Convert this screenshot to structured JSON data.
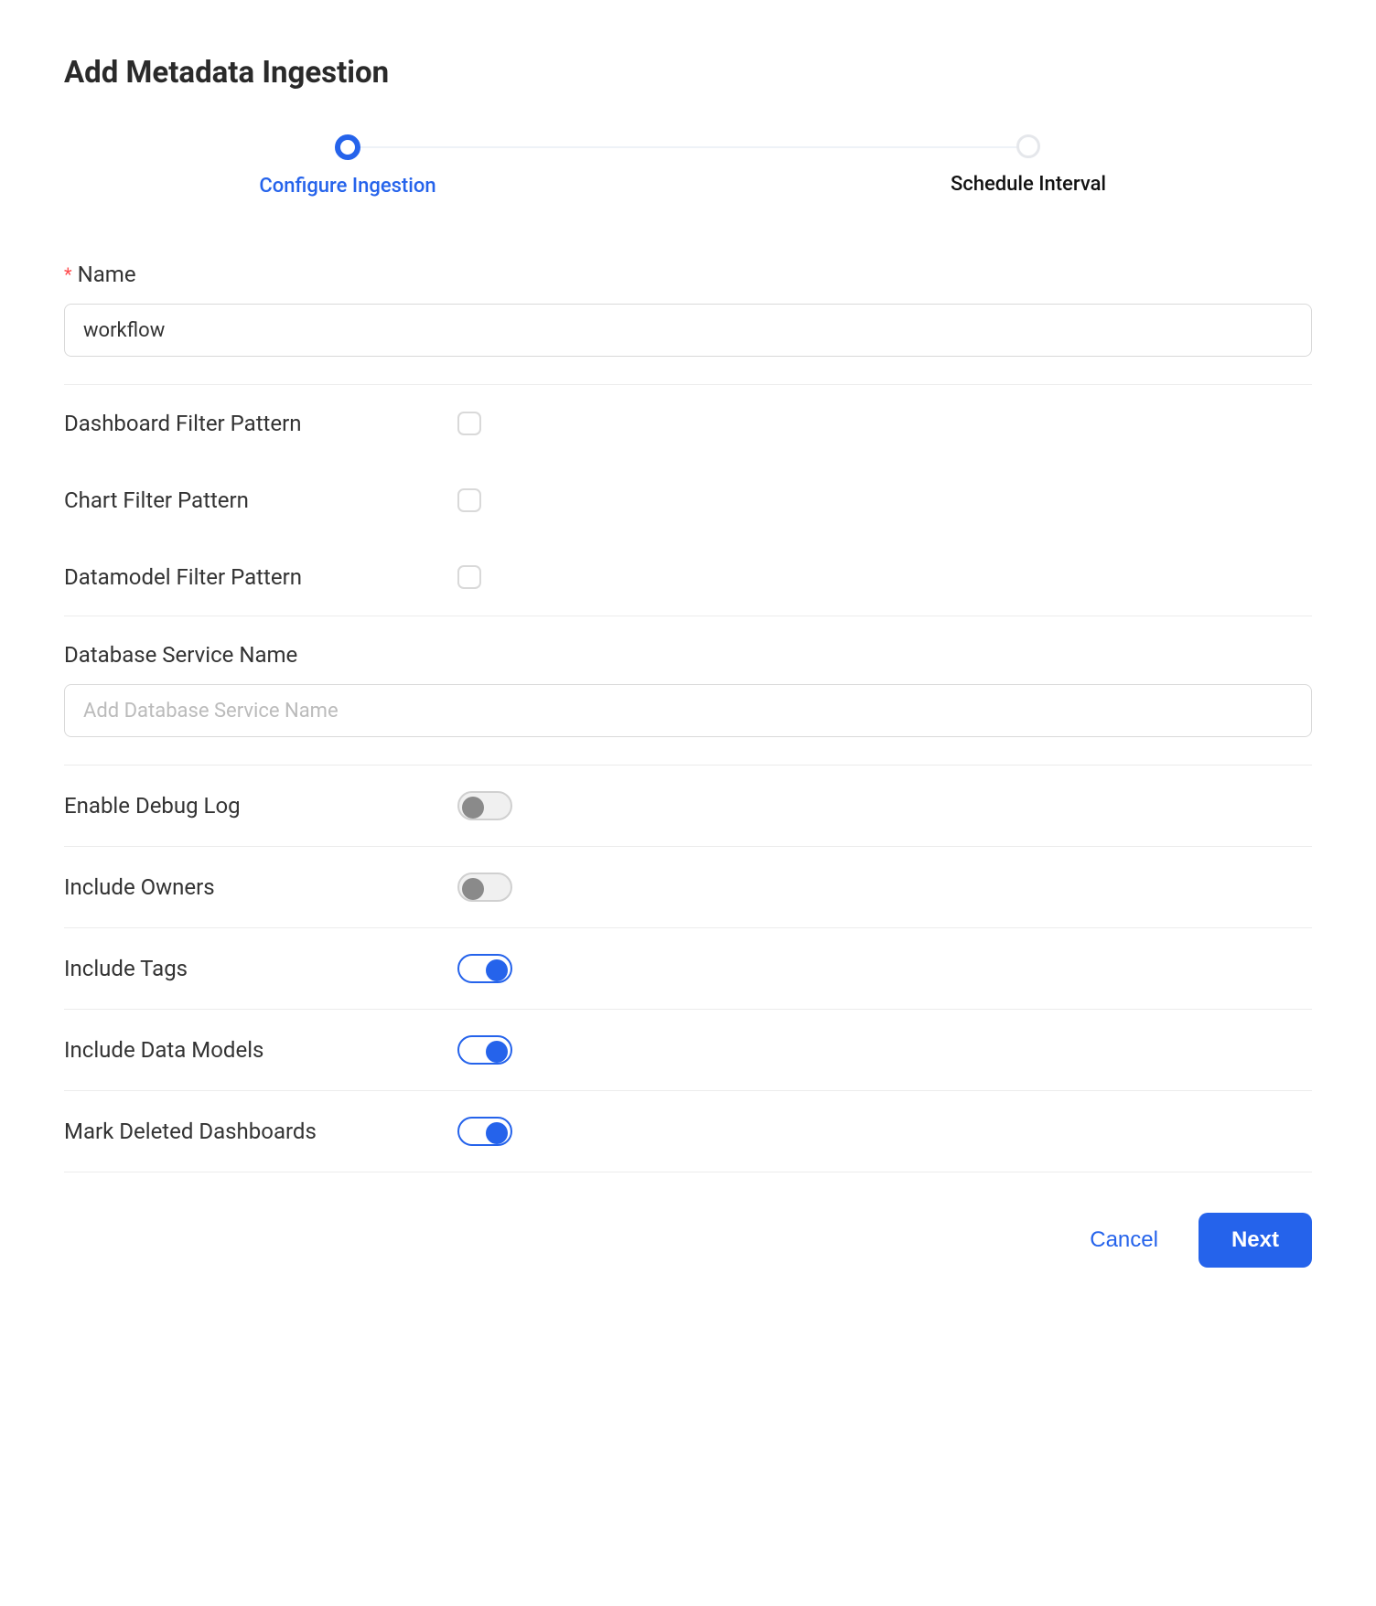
{
  "page": {
    "title": "Add Metadata Ingestion"
  },
  "stepper": {
    "steps": [
      {
        "label": "Configure Ingestion",
        "active": true
      },
      {
        "label": "Schedule Interval",
        "active": false
      }
    ]
  },
  "form": {
    "name": {
      "label": "Name",
      "required": true,
      "value": "workflow"
    },
    "filters": [
      {
        "label": "Dashboard Filter Pattern",
        "checked": false
      },
      {
        "label": "Chart Filter Pattern",
        "checked": false
      },
      {
        "label": "Datamodel Filter Pattern",
        "checked": false
      }
    ],
    "db_service": {
      "label": "Database Service Name",
      "placeholder": "Add Database Service Name",
      "value": ""
    },
    "toggles": [
      {
        "label": "Enable Debug Log",
        "on": false
      },
      {
        "label": "Include Owners",
        "on": false
      },
      {
        "label": "Include Tags",
        "on": true
      },
      {
        "label": "Include Data Models",
        "on": true
      },
      {
        "label": "Mark Deleted Dashboards",
        "on": true
      }
    ]
  },
  "footer": {
    "cancel": "Cancel",
    "next": "Next"
  }
}
